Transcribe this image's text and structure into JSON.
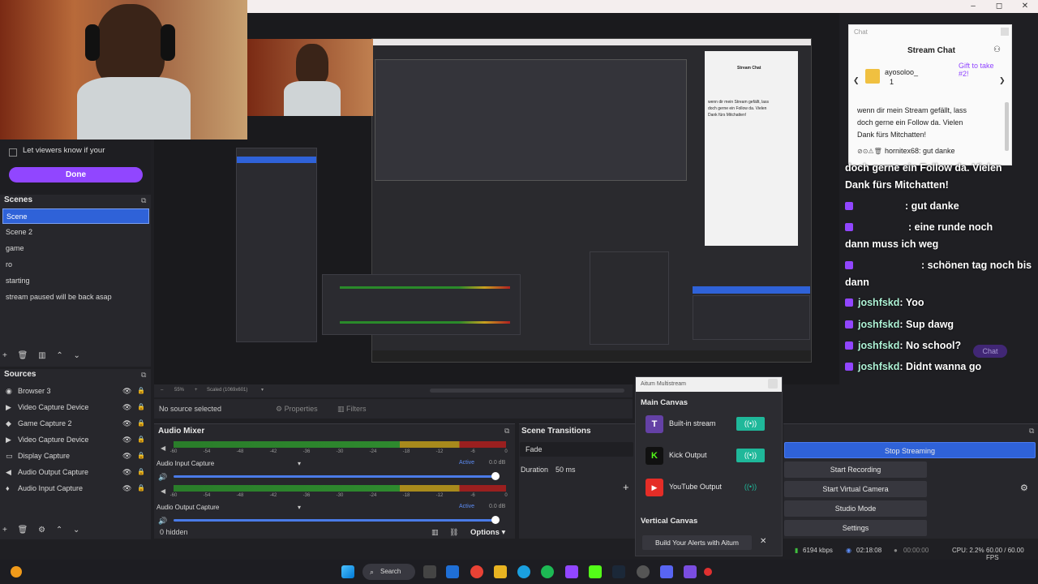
{
  "window_controls": {
    "minimize": "–",
    "maximize": "◻",
    "close": "✕"
  },
  "viewers_prompt": {
    "checkbox_label": "Let viewers know if your",
    "done_label": "Done"
  },
  "scenes": {
    "title": "Scenes",
    "items": [
      "Scene",
      "Scene 2",
      "game",
      "ro",
      "starting",
      "stream paused will be back asap"
    ],
    "selected": 0,
    "toolbar_icons": [
      "add-icon",
      "delete-icon",
      "filter-icon",
      "up-icon",
      "down-icon"
    ]
  },
  "sources": {
    "title": "Sources",
    "items": [
      {
        "name": "Browser 3",
        "icon": "browser-icon"
      },
      {
        "name": "Video Capture Device",
        "icon": "camera-icon"
      },
      {
        "name": "Game Capture 2",
        "icon": "gamepad-icon"
      },
      {
        "name": "Video Capture Device",
        "icon": "camera-icon"
      },
      {
        "name": "Display Capture",
        "icon": "monitor-icon"
      },
      {
        "name": "Audio Output Capture",
        "icon": "speaker-icon"
      },
      {
        "name": "Audio Input Capture",
        "icon": "mic-icon"
      }
    ]
  },
  "preview_bar": {
    "zoom": "55%",
    "scaled": "Scaled (1069x601)"
  },
  "properties_bar": {
    "no_source": "No source selected",
    "properties": "Properties",
    "filters": "Filters"
  },
  "mixer": {
    "title": "Audio Mixer",
    "scale": [
      "-60",
      "-54",
      "-48",
      "-42",
      "-36",
      "-30",
      "-24",
      "-18",
      "-12",
      "-6",
      "0"
    ],
    "channels": [
      {
        "name": "Audio Input Capture",
        "status": "Active",
        "db": "0.0 dB"
      },
      {
        "name": "Audio Output Capture",
        "status": "Active",
        "db": "0.0 dB"
      }
    ],
    "hidden": "0 hidden",
    "options": "Options"
  },
  "transitions": {
    "title": "Scene Transitions",
    "type": "Fade",
    "duration_label": "Duration",
    "duration_value": "50 ms"
  },
  "aitum": {
    "title": "Aitum Multistream",
    "main_canvas": "Main Canvas",
    "outputs": [
      {
        "name": "Built-in stream",
        "logo": "T",
        "color": "#6441a5",
        "active": true
      },
      {
        "name": "Kick Output",
        "logo": "K",
        "color": "#111111",
        "active": true
      },
      {
        "name": "YouTube Output",
        "logo": "▶",
        "color": "#e52d27",
        "active": false
      }
    ],
    "vertical_canvas": "Vertical Canvas",
    "alerts_btn": "Build Your Alerts with Aitum"
  },
  "controls": [
    "Stop Streaming",
    "Start Recording",
    "Start Virtual Camera",
    "Studio Mode",
    "Settings"
  ],
  "status": {
    "bitrate": "6194 kbps",
    "stream_time": "02:18:08",
    "rec_time": "00:00:00",
    "cpu": "CPU: 2.2%",
    "fps": "60.00 / 60.00 FPS"
  },
  "chat": {
    "header": "Chat",
    "title": "Stream Chat",
    "gift_user": "ayosoloo_",
    "gift_count": "1",
    "gift_text": "Gift to take #2!",
    "lines": [
      "wenn dir mein Stream gefällt, lass",
      "doch gerne ein Follow da. Vielen",
      "Dank fürs Mitchatten!",
      "hornitex68: gut danke"
    ]
  },
  "overlay_chat": [
    {
      "name": "",
      "text": "doch gerne ein Follow da. Vielen"
    },
    {
      "name": "",
      "text": "Dank fürs Mitchatten!"
    },
    {
      "name": "",
      "text": ": gut danke"
    },
    {
      "name": "",
      "text": ": eine runde noch"
    },
    {
      "name": "",
      "text": "dann muss ich weg"
    },
    {
      "name": "",
      "text": ": schönen tag noch bis"
    },
    {
      "name": "",
      "text": "dann"
    },
    {
      "name": "joshfskd",
      "text": ": Yoo"
    },
    {
      "name": "joshfskd",
      "text": ": Sup dawg"
    },
    {
      "name": "joshfskd",
      "text": ": No school?"
    },
    {
      "name": "joshfskd",
      "text": ": Didnt wanna go"
    }
  ],
  "overlay_chat_button": "Chat",
  "taskbar": {
    "search": "Search"
  }
}
